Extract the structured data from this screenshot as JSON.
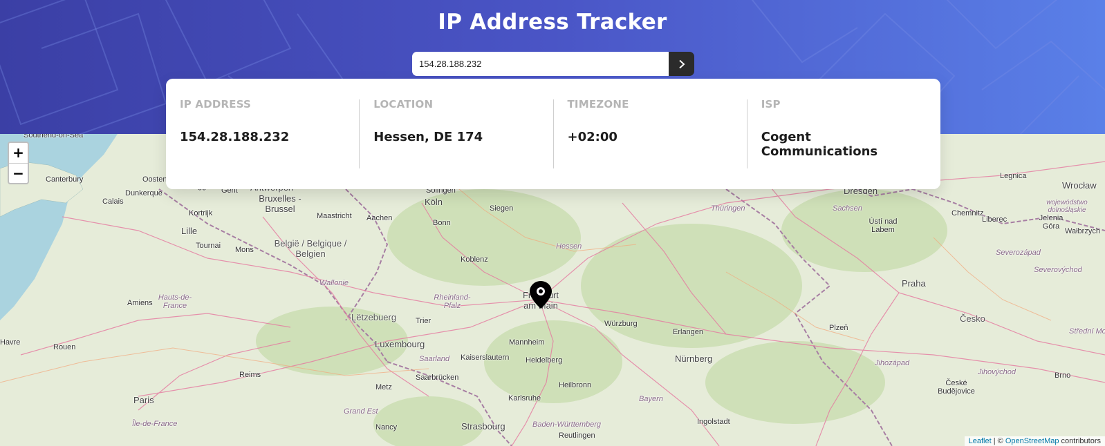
{
  "header": {
    "title": "IP Address Tracker"
  },
  "search": {
    "value": "154.28.188.232",
    "submit_icon": "chevron-right-icon"
  },
  "info": {
    "ip": {
      "label": "IP ADDRESS",
      "value": "154.28.188.232"
    },
    "location": {
      "label": "LOCATION",
      "value": "Hessen, DE 174"
    },
    "timezone": {
      "label": "TIMEZONE",
      "value": "+02:00"
    },
    "isp": {
      "label": "ISP",
      "value": "Cogent Communications"
    }
  },
  "map": {
    "zoom_in": "+",
    "zoom_out": "−",
    "marker_icon": "location-pin-icon",
    "attribution": {
      "leaflet": "Leaflet",
      "separator": " | © ",
      "osm": "OpenStreetMap",
      "suffix": " contributors"
    },
    "labels": [
      "Southend-on-Sea",
      "Canterbury",
      "Oostende",
      "Dunkerque",
      "Brugge",
      "Gent",
      "Antwerpen",
      "Solingen",
      "Calais",
      "Kortrijk",
      "Bruxelles - Brussel",
      "Maastricht",
      "Aachen",
      "Köln",
      "Siegen",
      "Dresden",
      "Legnica",
      "Wrocław",
      "Lille",
      "Bonn",
      "Thüringen",
      "Sachsen",
      "Chemnitz",
      "Ústí nad Labem",
      "Liberec",
      "Jelenia Góra",
      "Wałbrzych",
      "Tournai",
      "Mons",
      "België / Belgique / Belgien",
      "Hessen",
      "Koblenz",
      "Severozápad",
      "Wallonie",
      "Frankfurt am Main",
      "Praha",
      "Amiens",
      "Hauts-de-France",
      "Rheinland-Pfalz",
      "Lëtzebuerg",
      "Trier",
      "Würzburg",
      "Luxembourg",
      "Erlangen",
      "Plzeň",
      "Česko",
      "Mannheim",
      "Havre",
      "Rouen",
      "Kaiserslautern",
      "Heidelberg",
      "Saarland",
      "Nürnberg",
      "Jihozápad",
      "Jihovýchod",
      "Brno",
      "Saarbrücken",
      "Reims",
      "Metz",
      "Heilbronn",
      "České Budějovice",
      "Karlsruhe",
      "Paris",
      "Grand Est",
      "Bayern",
      "Île-de-France",
      "Strasbourg",
      "Nancy",
      "Baden-Württemberg",
      "Ingolstadt",
      "Reutlingen",
      "wojewódstwo dolnośląskie",
      "Severovýchod",
      "Střední Morava"
    ]
  }
}
